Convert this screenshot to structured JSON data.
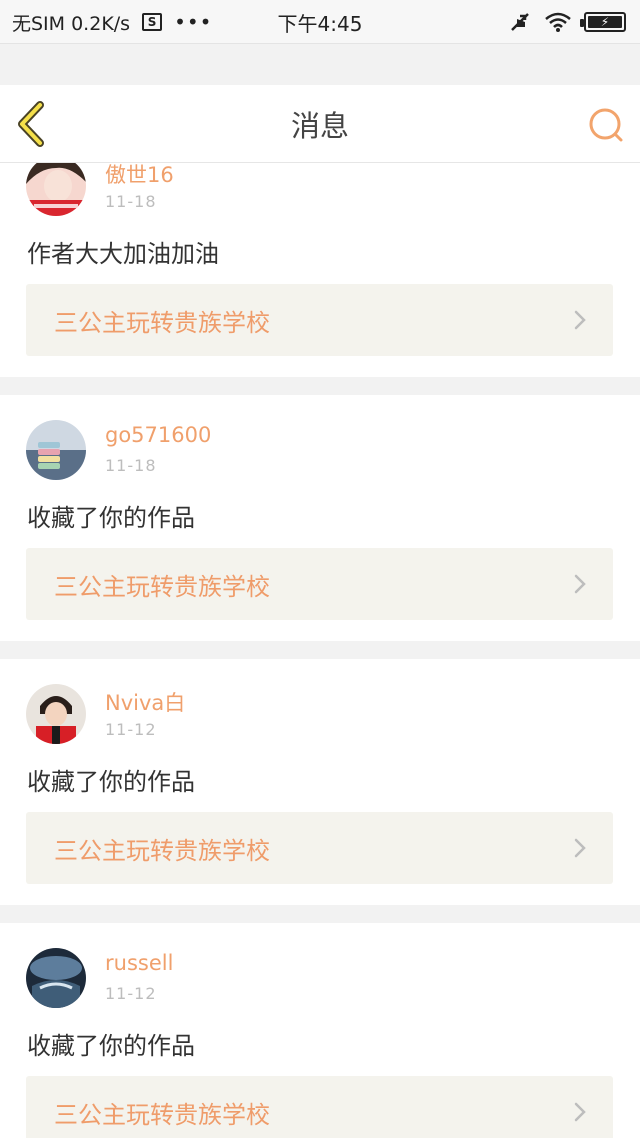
{
  "status_bar": {
    "carrier": "无SIM 0.2K/s",
    "sim_icon": "S",
    "dots": "•••",
    "time": "下午4:45"
  },
  "header": {
    "title": "消息"
  },
  "colors": {
    "accent": "#f0a06c",
    "work_bg": "#f4f3ed",
    "page_bg": "#f2f2f2"
  },
  "messages": [
    {
      "username": "傲世16",
      "date": "11-18",
      "text": "作者大大加油加油",
      "work": "三公主玩转贵族学校"
    },
    {
      "username": "go571600",
      "date": "11-18",
      "text": "收藏了你的作品",
      "work": "三公主玩转贵族学校"
    },
    {
      "username": "Nviva白",
      "date": "11-12",
      "text": "收藏了你的作品",
      "work": "三公主玩转贵族学校"
    },
    {
      "username": "russell",
      "date": "11-12",
      "text": "收藏了你的作品",
      "work": "三公主玩转贵族学校"
    }
  ]
}
